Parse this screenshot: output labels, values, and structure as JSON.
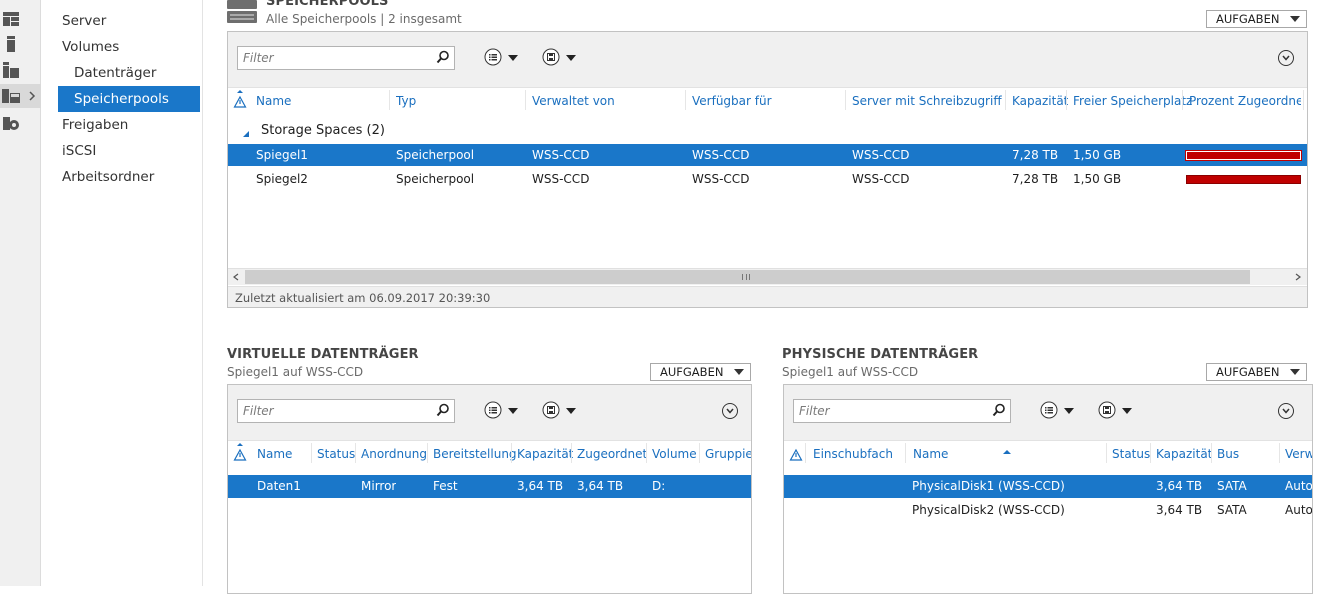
{
  "nav": {
    "items": [
      {
        "label": "Server"
      },
      {
        "label": "Volumes"
      },
      {
        "label": "Datenträger"
      },
      {
        "label": "Speicherpools"
      },
      {
        "label": "Freigaben"
      },
      {
        "label": "iSCSI"
      },
      {
        "label": "Arbeitsordner"
      }
    ]
  },
  "icons": [
    "dashboard-icon",
    "local-server-icon",
    "all-servers-icon",
    "file-storage-services-icon",
    "iis-icon"
  ],
  "pools": {
    "title": "SPEICHERPOOLS",
    "subtitle": "Alle Speicherpools | 2 insgesamt",
    "tasks_label": "AUFGABEN",
    "filter_placeholder": "Filter",
    "columns": [
      "Name",
      "Typ",
      "Verwaltet von",
      "Verfügbar für",
      "Server mit Schreibzugriff",
      "Kapazität",
      "Freier Speicherplatz",
      "Prozent Zugeordnet"
    ],
    "group_label": "Storage Spaces (2)",
    "rows": [
      {
        "name": "Spiegel1",
        "type": "Speicherpool",
        "managed_by": "WSS-CCD",
        "available_to": "WSS-CCD",
        "write_server": "WSS-CCD",
        "capacity": "7,28 TB",
        "free": "1,50 GB",
        "percent_allocated": 0.9998,
        "selected": true
      },
      {
        "name": "Spiegel2",
        "type": "Speicherpool",
        "managed_by": "WSS-CCD",
        "available_to": "WSS-CCD",
        "write_server": "WSS-CCD",
        "capacity": "7,28 TB",
        "free": "1,50 GB",
        "percent_allocated": 0.9998,
        "selected": false
      }
    ],
    "status": "Zuletzt aktualisiert am 06.09.2017 20:39:30",
    "bar_color": "#c00000"
  },
  "virtual": {
    "title": "VIRTUELLE DATENTRÄGER",
    "subtitle": "Spiegel1 auf WSS-CCD",
    "tasks_label": "AUFGABEN",
    "filter_placeholder": "Filter",
    "columns": [
      "Name",
      "Status",
      "Anordnung",
      "Bereitstellung",
      "Kapazität",
      "Zugeordnet",
      "Volume",
      "Gruppier"
    ],
    "rows": [
      {
        "name": "Daten1",
        "status": "",
        "layout": "Mirror",
        "provisioning": "Fest",
        "capacity": "3,64 TB",
        "allocated": "3,64 TB",
        "volume": "D:",
        "group": "",
        "selected": true
      }
    ]
  },
  "physical": {
    "title": "PHYSISCHE DATENTRÄGER",
    "subtitle": "Spiegel1 auf WSS-CCD",
    "tasks_label": "AUFGABEN",
    "filter_placeholder": "Filter",
    "columns": [
      "Einschubfach",
      "Name",
      "Status",
      "Kapazität",
      "Bus",
      "Verw"
    ],
    "rows": [
      {
        "slot": "",
        "name": "PhysicalDisk1 (WSS-CCD)",
        "status": "",
        "capacity": "3,64 TB",
        "bus": "SATA",
        "usage": "Auto",
        "selected": true
      },
      {
        "slot": "",
        "name": "PhysicalDisk2 (WSS-CCD)",
        "status": "",
        "capacity": "3,64 TB",
        "bus": "SATA",
        "usage": "Auto",
        "selected": false
      }
    ]
  },
  "colors": {
    "accent": "#1a77c9",
    "header_text": "#1a6fbf"
  }
}
